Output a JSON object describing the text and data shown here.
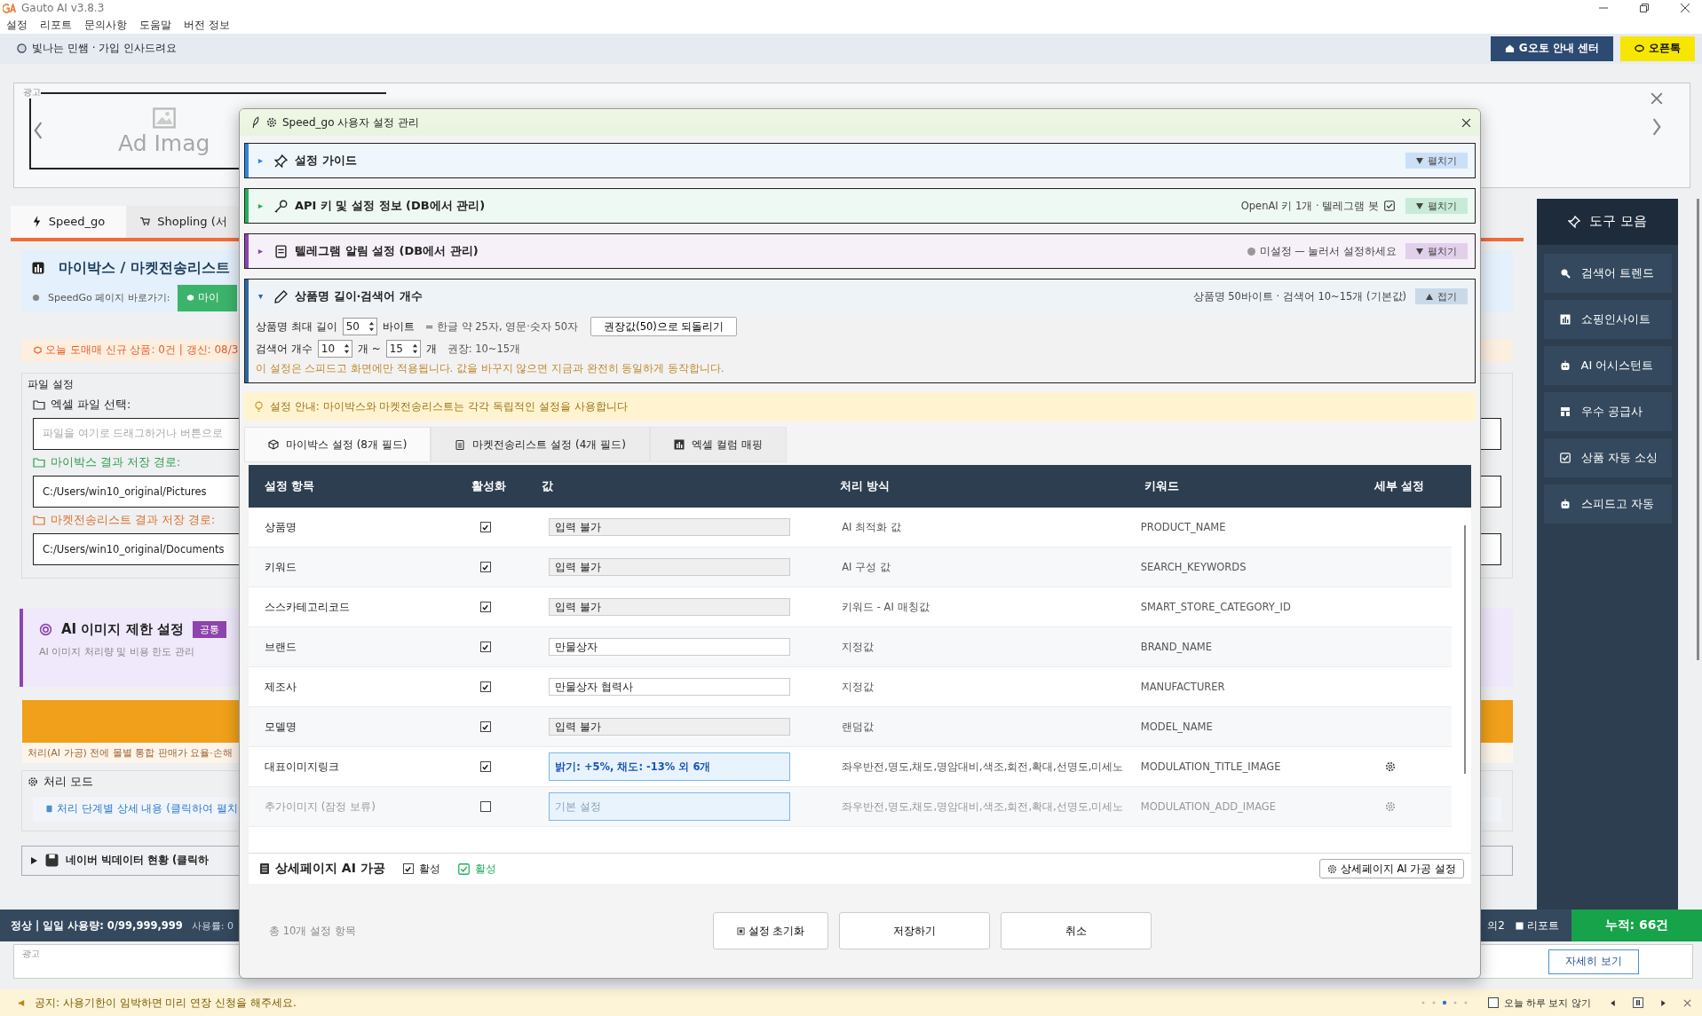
{
  "window": {
    "title": "Gauto AI v3.8.3"
  },
  "menu": [
    "설정",
    "리포트",
    "문의사항",
    "도움말",
    "버전 정보"
  ],
  "header": {
    "greeting": "빛나는 민쌤 · 가입 인사드려요",
    "buttons": [
      {
        "label": "G오토 안내 센터",
        "kind": "guide"
      },
      {
        "label": "오픈톡",
        "kind": "chat"
      }
    ]
  },
  "ad_banner": {
    "label": "광고",
    "placeholder": "Ad Imag"
  },
  "main_tabs": [
    {
      "label": "Speed_go",
      "selected": true,
      "kind": "bolt"
    },
    {
      "label": "Shopling (서",
      "selected": false,
      "kind": "cart"
    }
  ],
  "mybox_panel": {
    "title": "마이박스 / 마켓전송리스트",
    "link_label": "SpeedGo 페이지 바로가기:",
    "button": "마이"
  },
  "notice_today": "오늘 도매매 신규 상품: 0건 | 갱신: 08/3",
  "file_settings": {
    "title": "파일 설정",
    "excel_label": "엑셀 파일 선택:",
    "excel_placeholder": "파일을 여기로 드래그하거나 버튼으로",
    "mybox_path_label": "마이박스 결과 저장 경로:",
    "mybox_path": "C:/Users/win10_original/Pictures",
    "market_path_label": "마켓전송리스트 결과 저장 경로:",
    "market_path": "C:/Users/win10_original/Documents"
  },
  "ai_limit": {
    "title": "AI 이미지 제한 설정",
    "badge": "공통",
    "subtitle": "AI 이미지 처리량 및 비용 한도 관리"
  },
  "pricing_note": "처리(AI 가공) 전에 몰별 통합 판매가 요율·손해",
  "process_mode": {
    "title": "처리 모드",
    "details": "처리 단계별 상세 내용 (클릭하여 펼치"
  },
  "naver_data": {
    "title": "네이버 빅데이터 현황 (클릭하",
    "expanded": false
  },
  "tool_panel": {
    "title": "도구 모음",
    "items": [
      {
        "label": "검색어 트렌드",
        "kind": "search"
      },
      {
        "label": "쇼핑인사이트",
        "kind": "chart"
      },
      {
        "label": "AI 어시스턴트",
        "kind": "robot"
      },
      {
        "label": "우수 공급사",
        "kind": "store"
      },
      {
        "label": "상품 자동 소싱",
        "kind": "check"
      },
      {
        "label": "스피드고 자동",
        "kind": "robot"
      }
    ]
  },
  "status_bar": {
    "usage": "정상 | 일일 사용량: 0/99,999,999",
    "rate": "사용률: 0",
    "inquiry": "의2",
    "report": "리포트",
    "total": "누적: 66건"
  },
  "bottom_ad": {
    "label": "광고",
    "button": "자세히 보기"
  },
  "notice": {
    "text": "공지: 사용기한이 임박하면 미리 연장 신청을 해주세요.",
    "dont_show_today": {
      "label": "오늘 하루 보지 않기",
      "checked": false
    }
  },
  "dialog": {
    "title": "Speed_go 사용자 설정 관리",
    "sections": [
      {
        "title": "설정 가이드",
        "kind": "pin",
        "color": "#2e86de",
        "expanded": false,
        "toggle": "펼치기"
      },
      {
        "title": "API 키 및 설정 정보 (DB에서 관리)",
        "kind": "key",
        "color": "#27ae60",
        "expanded": false,
        "toggle": "펼치기",
        "summary": "OpenAI 키 1개 · 텔레그램 봇",
        "summary_checked": true
      },
      {
        "title": "텔레그램 알림 설정 (DB에서 관리)",
        "kind": "device",
        "color": "#8e44ad",
        "expanded": false,
        "toggle": "펼치기",
        "summary": "미설정 — 눌러서 설정하세요",
        "summary_dot": true
      },
      {
        "title": "상품명 길이·검색어 개수",
        "kind": "pencil",
        "color": "#2c6aa0",
        "expanded": true,
        "toggle": "접기",
        "summary": "상품명 50바이트 · 검색어 10~15개 (기본값)",
        "body": {
          "max_label": "상품명 최대 길이",
          "max_value": "50",
          "max_unit": "바이트",
          "max_hint": "= 한글 약 25자, 영문·숫자 50자",
          "reset_button": "권장값(50)으로 되돌리기",
          "count_label": "검색어 개수",
          "count_min": "10",
          "count_sep": "개 ~",
          "count_max": "15",
          "count_unit": "개",
          "count_hint": "권장: 10~15개",
          "note": "이 설정은 스피드고 화면에만 적용됩니다. 값을 바꾸지 않으면 지금과 완전히 동일하게 동작합니다."
        }
      }
    ],
    "info": "설정 안내: 마이박스와 마켓전송리스트는 각각 독립적인 설정을 사용합니다",
    "tabs": [
      {
        "label": "마이박스 설정 (8개 필드)",
        "kind": "box",
        "selected": true
      },
      {
        "label": "마켓전송리스트 설정 (4개 필드)",
        "kind": "clipboard",
        "selected": false
      },
      {
        "label": "엑셀 컬럼 매핑",
        "kind": "chart",
        "selected": false
      }
    ],
    "table": {
      "columns": [
        "설정 항목",
        "활성화",
        "값",
        "처리 방식",
        "키워드",
        "세부 설정"
      ],
      "rows": [
        {
          "item": "상품명",
          "enabled": true,
          "value": "입력 불가",
          "kind": "locked",
          "method": "AI 최적화 값",
          "keyword": "PRODUCT_NAME",
          "detail": false
        },
        {
          "item": "키워드",
          "enabled": true,
          "value": "입력 불가",
          "kind": "locked",
          "method": "AI 구성 값",
          "keyword": "SEARCH_KEYWORDS",
          "detail": false
        },
        {
          "item": "스스카테고리코드",
          "enabled": true,
          "value": "입력 불가",
          "kind": "locked",
          "method": "키워드 - AI 매칭값",
          "keyword": "SMART_STORE_CATEGORY_ID",
          "detail": false
        },
        {
          "item": "브랜드",
          "enabled": true,
          "value": "만물상자",
          "kind": "text",
          "method": "지정값",
          "keyword": "BRAND_NAME",
          "detail": false
        },
        {
          "item": "제조사",
          "enabled": true,
          "value": "만물상자 협력사",
          "kind": "text",
          "method": "지정값",
          "keyword": "MANUFACTURER",
          "detail": false
        },
        {
          "item": "모델명",
          "enabled": true,
          "value": "입력 불가",
          "kind": "locked",
          "method": "랜덤값",
          "keyword": "MODEL_NAME",
          "detail": false
        },
        {
          "item": "대표이미지링크",
          "enabled": true,
          "value": "밝기: +5%, 채도: -13% 외 6개",
          "kind": "modulation",
          "method": "좌우반전,명도,채도,명암대비,색조,회전,확대,선명도,미세노",
          "keyword": "MODULATION_TITLE_IMAGE",
          "detail": true
        },
        {
          "item": "추가이미지 (잠정 보류)",
          "enabled": false,
          "value": "기본 설정",
          "kind": "modulation",
          "method": "좌우반전,명도,채도,명암대비,색조,회전,확대,선명도,미세노",
          "keyword": "MODULATION_ADD_IMAGE",
          "detail": true
        }
      ]
    },
    "detail_bar": {
      "title": "상세페이지 AI 가공",
      "checkbox": {
        "label": "활성",
        "checked": true
      },
      "status": {
        "label": "활성",
        "checked": true
      },
      "button": "상세페이지 AI 가공 설정"
    },
    "footer": {
      "count": "총 10개 설정 항목",
      "buttons": [
        {
          "label": "설정 초기화",
          "kind": "reset"
        },
        {
          "label": "저장하기",
          "kind": "save"
        },
        {
          "label": "취소",
          "kind": "cancel"
        }
      ]
    }
  }
}
